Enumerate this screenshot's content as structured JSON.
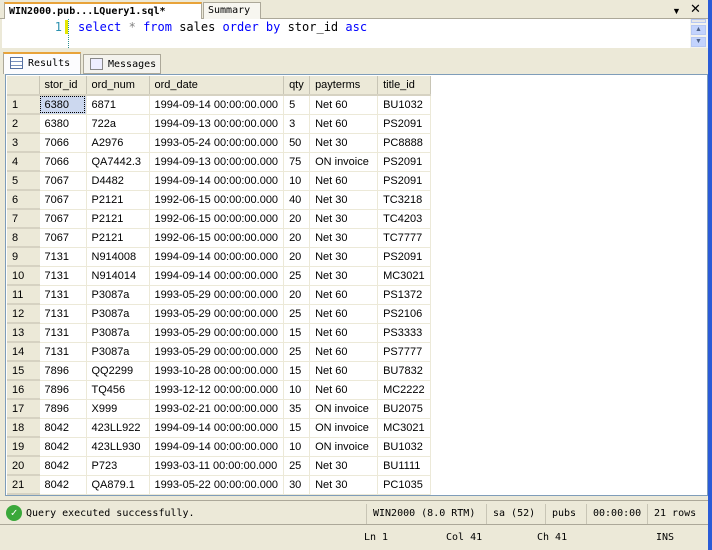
{
  "tabs": {
    "document_tab": "WIN2000.pub...LQuery1.sql*",
    "summary_tab": "Summary",
    "dropdown_icon": "triangle-down",
    "close_icon": "x"
  },
  "editor": {
    "line_number": "1",
    "tokens": [
      {
        "t": "select",
        "c": "kw"
      },
      {
        "t": " "
      },
      {
        "t": "*",
        "c": "op"
      },
      {
        "t": " "
      },
      {
        "t": "from",
        "c": "kw"
      },
      {
        "t": " sales "
      },
      {
        "t": "order",
        "c": "kw"
      },
      {
        "t": " "
      },
      {
        "t": "by",
        "c": "kw"
      },
      {
        "t": " stor_id "
      },
      {
        "t": "asc",
        "c": "kw"
      }
    ]
  },
  "results_tabs": {
    "results": "Results",
    "messages": "Messages"
  },
  "grid": {
    "columns": [
      "stor_id",
      "ord_num",
      "ord_date",
      "qty",
      "payterms",
      "title_id"
    ],
    "rows": [
      [
        "6380",
        "6871",
        "1994-09-14 00:00:00.000",
        "5",
        "Net 60",
        "BU1032"
      ],
      [
        "6380",
        "722a",
        "1994-09-13 00:00:00.000",
        "3",
        "Net 60",
        "PS2091"
      ],
      [
        "7066",
        "A2976",
        "1993-05-24 00:00:00.000",
        "50",
        "Net 30",
        "PC8888"
      ],
      [
        "7066",
        "QA7442.3",
        "1994-09-13 00:00:00.000",
        "75",
        "ON invoice",
        "PS2091"
      ],
      [
        "7067",
        "D4482",
        "1994-09-14 00:00:00.000",
        "10",
        "Net 60",
        "PS2091"
      ],
      [
        "7067",
        "P2121",
        "1992-06-15 00:00:00.000",
        "40",
        "Net 30",
        "TC3218"
      ],
      [
        "7067",
        "P2121",
        "1992-06-15 00:00:00.000",
        "20",
        "Net 30",
        "TC4203"
      ],
      [
        "7067",
        "P2121",
        "1992-06-15 00:00:00.000",
        "20",
        "Net 30",
        "TC7777"
      ],
      [
        "7131",
        "N914008",
        "1994-09-14 00:00:00.000",
        "20",
        "Net 30",
        "PS2091"
      ],
      [
        "7131",
        "N914014",
        "1994-09-14 00:00:00.000",
        "25",
        "Net 30",
        "MC3021"
      ],
      [
        "7131",
        "P3087a",
        "1993-05-29 00:00:00.000",
        "20",
        "Net 60",
        "PS1372"
      ],
      [
        "7131",
        "P3087a",
        "1993-05-29 00:00:00.000",
        "25",
        "Net 60",
        "PS2106"
      ],
      [
        "7131",
        "P3087a",
        "1993-05-29 00:00:00.000",
        "15",
        "Net 60",
        "PS3333"
      ],
      [
        "7131",
        "P3087a",
        "1993-05-29 00:00:00.000",
        "25",
        "Net 60",
        "PS7777"
      ],
      [
        "7896",
        "QQ2299",
        "1993-10-28 00:00:00.000",
        "15",
        "Net 60",
        "BU7832"
      ],
      [
        "7896",
        "TQ456",
        "1993-12-12 00:00:00.000",
        "10",
        "Net 60",
        "MC2222"
      ],
      [
        "7896",
        "X999",
        "1993-02-21 00:00:00.000",
        "35",
        "ON invoice",
        "BU2075"
      ],
      [
        "8042",
        "423LL922",
        "1994-09-14 00:00:00.000",
        "15",
        "ON invoice",
        "MC3021"
      ],
      [
        "8042",
        "423LL930",
        "1994-09-14 00:00:00.000",
        "10",
        "ON invoice",
        "BU1032"
      ],
      [
        "8042",
        "P723",
        "1993-03-11 00:00:00.000",
        "25",
        "Net 30",
        "BU1111"
      ],
      [
        "8042",
        "QA879.1",
        "1993-05-22 00:00:00.000",
        "30",
        "Net 30",
        "PC1035"
      ]
    ]
  },
  "status": {
    "message": "Query executed successfully.",
    "server": "WIN2000 (8.0 RTM)",
    "user": "sa (52)",
    "database": "pubs",
    "elapsed": "00:00:00",
    "rows": "21 rows"
  },
  "bottom_status": {
    "ln": "Ln 1",
    "col": "Col 41",
    "ch": "Ch 41",
    "mode": "INS"
  }
}
